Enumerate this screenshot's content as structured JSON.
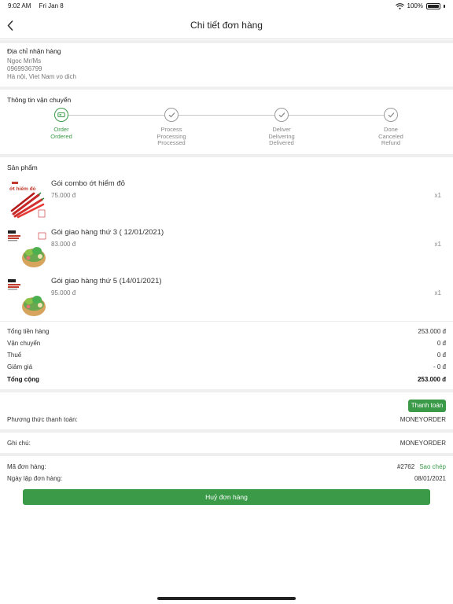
{
  "status_bar": {
    "time": "9:02 AM",
    "date": "Fri Jan 8",
    "battery": "100%"
  },
  "nav": {
    "title": "Chi tiết đơn hàng"
  },
  "address": {
    "title": "Địa chỉ nhận hàng",
    "name": "Ngoc Mr/Ms",
    "phone": "0969936799",
    "location": "Hà nội, Viet Nam vo dich"
  },
  "shipping": {
    "title": "Thông tin vận chuyển",
    "steps": [
      {
        "l1": "Order",
        "l2": "Ordered",
        "l3": "",
        "active": true
      },
      {
        "l1": "Process",
        "l2": "Processing",
        "l3": "Processed",
        "active": false
      },
      {
        "l1": "Deliver",
        "l2": "Delivering",
        "l3": "Delivered",
        "active": false
      },
      {
        "l1": "Done",
        "l2": "Canceled",
        "l3": "Refund",
        "active": false
      }
    ]
  },
  "products": {
    "title": "Sản phẩm",
    "items": [
      {
        "name": "Gói combo ớt hiểm đỏ",
        "price": "75.000 đ",
        "qty": "x1",
        "image_label": "ớt hiểm đỏ"
      },
      {
        "name": "Gói giao hàng thứ 3 ( 12/01/2021)",
        "price": "83.000 đ",
        "qty": "x1"
      },
      {
        "name": "Gói giao hàng thứ 5 (14/01/2021)",
        "price": "95.000 đ",
        "qty": "x1"
      }
    ]
  },
  "summary": {
    "subtotal_label": "Tổng tiền hàng",
    "subtotal": "253.000 đ",
    "shipping_label": "Vận chuyển",
    "shipping": "0 đ",
    "tax_label": "Thuế",
    "tax": "0 đ",
    "discount_label": "Giảm giá",
    "discount": "- 0 đ",
    "total_label": "Tổng cộng",
    "total": "253.000 đ"
  },
  "payment": {
    "pay_button": "Thanh toán",
    "method_label": "Phương thức thanh toán:",
    "method": "MONEYORDER"
  },
  "note": {
    "label": "Ghi chú:",
    "value": "MONEYORDER"
  },
  "order": {
    "id_label": "Mã đơn hàng:",
    "id": "#2762",
    "copy": "Sao chép",
    "date_label": "Ngày lập đơn hàng:",
    "date": "08/01/2021",
    "cancel_button": "Huỷ đơn hàng"
  },
  "colors": {
    "accent": "#3a9a48",
    "divider": "#efefef",
    "muted": "#777777"
  }
}
